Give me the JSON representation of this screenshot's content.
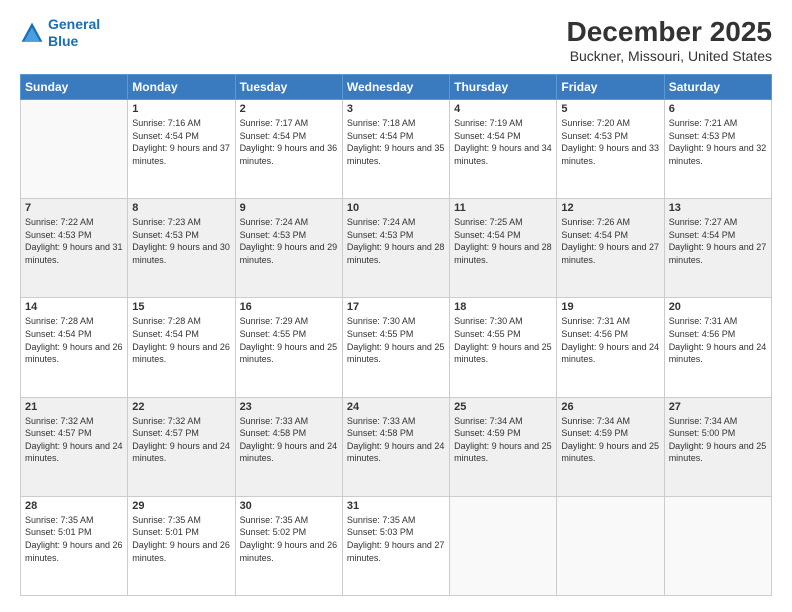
{
  "header": {
    "logo_line1": "General",
    "logo_line2": "Blue",
    "month_title": "December 2025",
    "location": "Buckner, Missouri, United States"
  },
  "days_of_week": [
    "Sunday",
    "Monday",
    "Tuesday",
    "Wednesday",
    "Thursday",
    "Friday",
    "Saturday"
  ],
  "weeks": [
    [
      {
        "day": "",
        "sunrise": "",
        "sunset": "",
        "daylight": ""
      },
      {
        "day": "1",
        "sunrise": "Sunrise: 7:16 AM",
        "sunset": "Sunset: 4:54 PM",
        "daylight": "Daylight: 9 hours and 37 minutes."
      },
      {
        "day": "2",
        "sunrise": "Sunrise: 7:17 AM",
        "sunset": "Sunset: 4:54 PM",
        "daylight": "Daylight: 9 hours and 36 minutes."
      },
      {
        "day": "3",
        "sunrise": "Sunrise: 7:18 AM",
        "sunset": "Sunset: 4:54 PM",
        "daylight": "Daylight: 9 hours and 35 minutes."
      },
      {
        "day": "4",
        "sunrise": "Sunrise: 7:19 AM",
        "sunset": "Sunset: 4:54 PM",
        "daylight": "Daylight: 9 hours and 34 minutes."
      },
      {
        "day": "5",
        "sunrise": "Sunrise: 7:20 AM",
        "sunset": "Sunset: 4:53 PM",
        "daylight": "Daylight: 9 hours and 33 minutes."
      },
      {
        "day": "6",
        "sunrise": "Sunrise: 7:21 AM",
        "sunset": "Sunset: 4:53 PM",
        "daylight": "Daylight: 9 hours and 32 minutes."
      }
    ],
    [
      {
        "day": "7",
        "sunrise": "Sunrise: 7:22 AM",
        "sunset": "Sunset: 4:53 PM",
        "daylight": "Daylight: 9 hours and 31 minutes."
      },
      {
        "day": "8",
        "sunrise": "Sunrise: 7:23 AM",
        "sunset": "Sunset: 4:53 PM",
        "daylight": "Daylight: 9 hours and 30 minutes."
      },
      {
        "day": "9",
        "sunrise": "Sunrise: 7:24 AM",
        "sunset": "Sunset: 4:53 PM",
        "daylight": "Daylight: 9 hours and 29 minutes."
      },
      {
        "day": "10",
        "sunrise": "Sunrise: 7:24 AM",
        "sunset": "Sunset: 4:53 PM",
        "daylight": "Daylight: 9 hours and 28 minutes."
      },
      {
        "day": "11",
        "sunrise": "Sunrise: 7:25 AM",
        "sunset": "Sunset: 4:54 PM",
        "daylight": "Daylight: 9 hours and 28 minutes."
      },
      {
        "day": "12",
        "sunrise": "Sunrise: 7:26 AM",
        "sunset": "Sunset: 4:54 PM",
        "daylight": "Daylight: 9 hours and 27 minutes."
      },
      {
        "day": "13",
        "sunrise": "Sunrise: 7:27 AM",
        "sunset": "Sunset: 4:54 PM",
        "daylight": "Daylight: 9 hours and 27 minutes."
      }
    ],
    [
      {
        "day": "14",
        "sunrise": "Sunrise: 7:28 AM",
        "sunset": "Sunset: 4:54 PM",
        "daylight": "Daylight: 9 hours and 26 minutes."
      },
      {
        "day": "15",
        "sunrise": "Sunrise: 7:28 AM",
        "sunset": "Sunset: 4:54 PM",
        "daylight": "Daylight: 9 hours and 26 minutes."
      },
      {
        "day": "16",
        "sunrise": "Sunrise: 7:29 AM",
        "sunset": "Sunset: 4:55 PM",
        "daylight": "Daylight: 9 hours and 25 minutes."
      },
      {
        "day": "17",
        "sunrise": "Sunrise: 7:30 AM",
        "sunset": "Sunset: 4:55 PM",
        "daylight": "Daylight: 9 hours and 25 minutes."
      },
      {
        "day": "18",
        "sunrise": "Sunrise: 7:30 AM",
        "sunset": "Sunset: 4:55 PM",
        "daylight": "Daylight: 9 hours and 25 minutes."
      },
      {
        "day": "19",
        "sunrise": "Sunrise: 7:31 AM",
        "sunset": "Sunset: 4:56 PM",
        "daylight": "Daylight: 9 hours and 24 minutes."
      },
      {
        "day": "20",
        "sunrise": "Sunrise: 7:31 AM",
        "sunset": "Sunset: 4:56 PM",
        "daylight": "Daylight: 9 hours and 24 minutes."
      }
    ],
    [
      {
        "day": "21",
        "sunrise": "Sunrise: 7:32 AM",
        "sunset": "Sunset: 4:57 PM",
        "daylight": "Daylight: 9 hours and 24 minutes."
      },
      {
        "day": "22",
        "sunrise": "Sunrise: 7:32 AM",
        "sunset": "Sunset: 4:57 PM",
        "daylight": "Daylight: 9 hours and 24 minutes."
      },
      {
        "day": "23",
        "sunrise": "Sunrise: 7:33 AM",
        "sunset": "Sunset: 4:58 PM",
        "daylight": "Daylight: 9 hours and 24 minutes."
      },
      {
        "day": "24",
        "sunrise": "Sunrise: 7:33 AM",
        "sunset": "Sunset: 4:58 PM",
        "daylight": "Daylight: 9 hours and 24 minutes."
      },
      {
        "day": "25",
        "sunrise": "Sunrise: 7:34 AM",
        "sunset": "Sunset: 4:59 PM",
        "daylight": "Daylight: 9 hours and 25 minutes."
      },
      {
        "day": "26",
        "sunrise": "Sunrise: 7:34 AM",
        "sunset": "Sunset: 4:59 PM",
        "daylight": "Daylight: 9 hours and 25 minutes."
      },
      {
        "day": "27",
        "sunrise": "Sunrise: 7:34 AM",
        "sunset": "Sunset: 5:00 PM",
        "daylight": "Daylight: 9 hours and 25 minutes."
      }
    ],
    [
      {
        "day": "28",
        "sunrise": "Sunrise: 7:35 AM",
        "sunset": "Sunset: 5:01 PM",
        "daylight": "Daylight: 9 hours and 26 minutes."
      },
      {
        "day": "29",
        "sunrise": "Sunrise: 7:35 AM",
        "sunset": "Sunset: 5:01 PM",
        "daylight": "Daylight: 9 hours and 26 minutes."
      },
      {
        "day": "30",
        "sunrise": "Sunrise: 7:35 AM",
        "sunset": "Sunset: 5:02 PM",
        "daylight": "Daylight: 9 hours and 26 minutes."
      },
      {
        "day": "31",
        "sunrise": "Sunrise: 7:35 AM",
        "sunset": "Sunset: 5:03 PM",
        "daylight": "Daylight: 9 hours and 27 minutes."
      },
      {
        "day": "",
        "sunrise": "",
        "sunset": "",
        "daylight": ""
      },
      {
        "day": "",
        "sunrise": "",
        "sunset": "",
        "daylight": ""
      },
      {
        "day": "",
        "sunrise": "",
        "sunset": "",
        "daylight": ""
      }
    ]
  ]
}
